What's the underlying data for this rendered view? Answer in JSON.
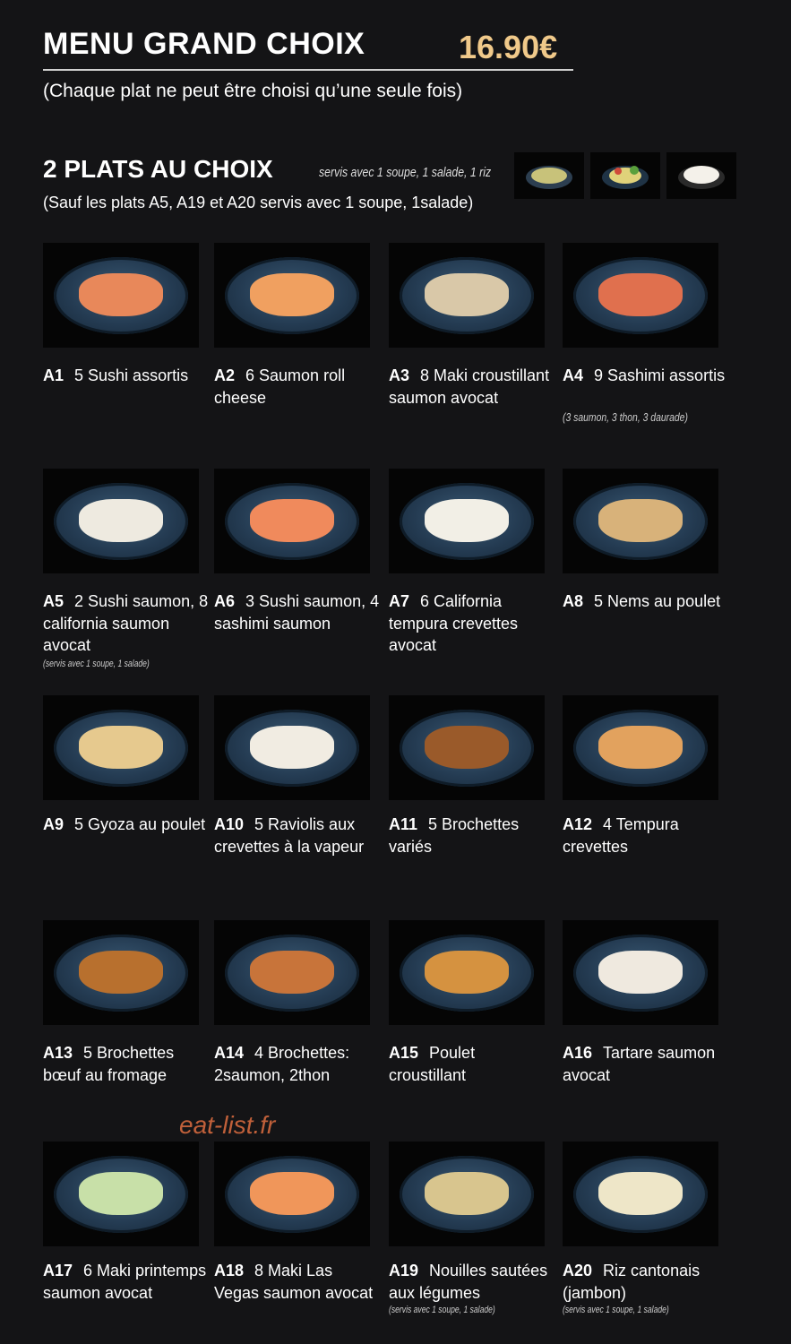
{
  "header": {
    "title": "MENU GRAND CHOIX",
    "price": "16.90€",
    "subtitle": "(Chaque plat ne peut être choisi qu’une seule fois)"
  },
  "section": {
    "title": "2 PLATS AU CHOIX",
    "served_with": "servis avec 1 soupe, 1 salade, 1 riz",
    "note": "(Sauf les plats A5, A19 et A20 servis avec 1 soupe, 1salade)",
    "side_images": [
      "soup",
      "salad",
      "rice"
    ]
  },
  "items": [
    {
      "code": "A1",
      "name": "5 Sushi assortis",
      "food_color": "#e8885a"
    },
    {
      "code": "A2",
      "name": "6 Saumon roll cheese",
      "food_color": "#f0a060"
    },
    {
      "code": "A3",
      "name": "8 Maki croustillant saumon avocat",
      "food_color": "#d9c8a8"
    },
    {
      "code": "A4",
      "name": "9 Sashimi assortis",
      "detail": "(3 saumon, 3 thon, 3 daurade)",
      "food_color": "#e0704e"
    },
    {
      "code": "A5",
      "name": "2 Sushi saumon, 8 california saumon avocat",
      "served": "(servis avec 1 soupe, 1 salade)",
      "food_color": "#eeeae0"
    },
    {
      "code": "A6",
      "name": "3 Sushi saumon, 4 sashimi saumon",
      "food_color": "#f08a5c"
    },
    {
      "code": "A7",
      "name": "6 California tempura crevettes avocat",
      "food_color": "#f2efe6"
    },
    {
      "code": "A8",
      "name": "5 Nems au poulet",
      "food_color": "#d8b27a"
    },
    {
      "code": "A9",
      "name": "5 Gyoza au poulet",
      "food_color": "#e6c98e"
    },
    {
      "code": "A10",
      "name": "5 Raviolis aux crevettes à la vapeur",
      "food_color": "#f1ece2"
    },
    {
      "code": "A11",
      "name": "5 Brochettes variés",
      "food_color": "#9a5a2a"
    },
    {
      "code": "A12",
      "name": "4 Tempura crevettes",
      "food_color": "#e2a25e"
    },
    {
      "code": "A13",
      "name": "5 Brochettes bœuf au fromage",
      "food_color": "#b8702e"
    },
    {
      "code": "A14",
      "name": "4 Brochettes: 2saumon, 2thon",
      "food_color": "#c8743a"
    },
    {
      "code": "A15",
      "name": "Poulet croustillant",
      "food_color": "#d59240"
    },
    {
      "code": "A16",
      "name": "Tartare saumon avocat",
      "food_color": "#efe9df"
    },
    {
      "code": "A17",
      "name": "6 Maki printemps saumon avocat",
      "food_color": "#c8e0a8"
    },
    {
      "code": "A18",
      "name": "8 Maki Las Vegas saumon avocat",
      "food_color": "#f0965a"
    },
    {
      "code": "A19",
      "name": "Nouilles sautées aux légumes",
      "served": "(servis avec 1 soupe, 1 salade)",
      "food_color": "#d8c58e"
    },
    {
      "code": "A20",
      "name": "Riz cantonais (jambon)",
      "served": "(servis avec 1 soupe, 1 salade)",
      "food_color": "#eee6c8"
    }
  ],
  "watermark": "eat-list.fr"
}
